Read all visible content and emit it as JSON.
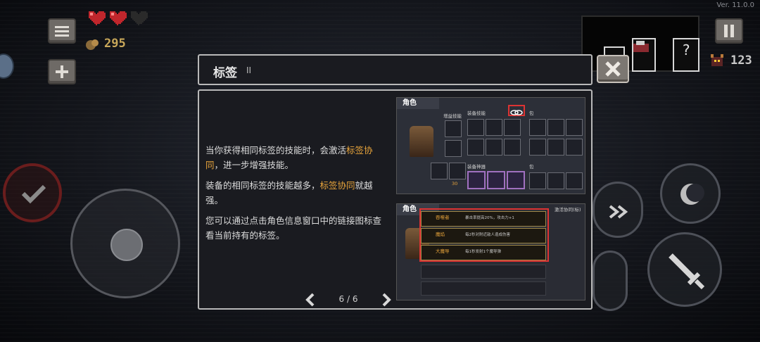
{
  "version": "Ver. 11.0.0",
  "hud": {
    "coins": "295",
    "enemies": "123",
    "hearts": [
      "full",
      "full",
      "empty"
    ]
  },
  "dialog": {
    "title": "标签",
    "roman": "II",
    "paragraphs": [
      {
        "before": "当你获得相同标签的技能时，会激活",
        "highlight": "标签协同",
        "after": "，进一步增强技能。"
      },
      {
        "before": "装备的相同标签的技能越多，",
        "highlight": "标签协同",
        "after": "就越强。"
      },
      {
        "before": "您可以通过点击角色信息窗口中的链接图标查看当前持有的标签。",
        "highlight": "",
        "after": ""
      }
    ],
    "page_indicator": "6 / 6"
  },
  "preview1": {
    "header": "角色",
    "equip_skills": "装备技能",
    "bag": "包",
    "equip_sacred": "装备神器",
    "bag2": "包",
    "owned_skills": "增益技能",
    "count": "30"
  },
  "preview2": {
    "header": "角色",
    "tag_title": "激活协同(标)",
    "rows": [
      {
        "name": "吞噬者",
        "desc": "暴击率提高20%，攻击力+1"
      },
      {
        "name": "魔焰",
        "desc": "每2秒对附近敌人造成伤害"
      },
      {
        "name": "大魔导",
        "desc": "每1秒发射1个魔导弹"
      }
    ]
  },
  "colors": {
    "highlight": "#e9a53b",
    "border": "#b9b9b9",
    "panel": "#1a1b20",
    "accent_red": "#d33333"
  }
}
